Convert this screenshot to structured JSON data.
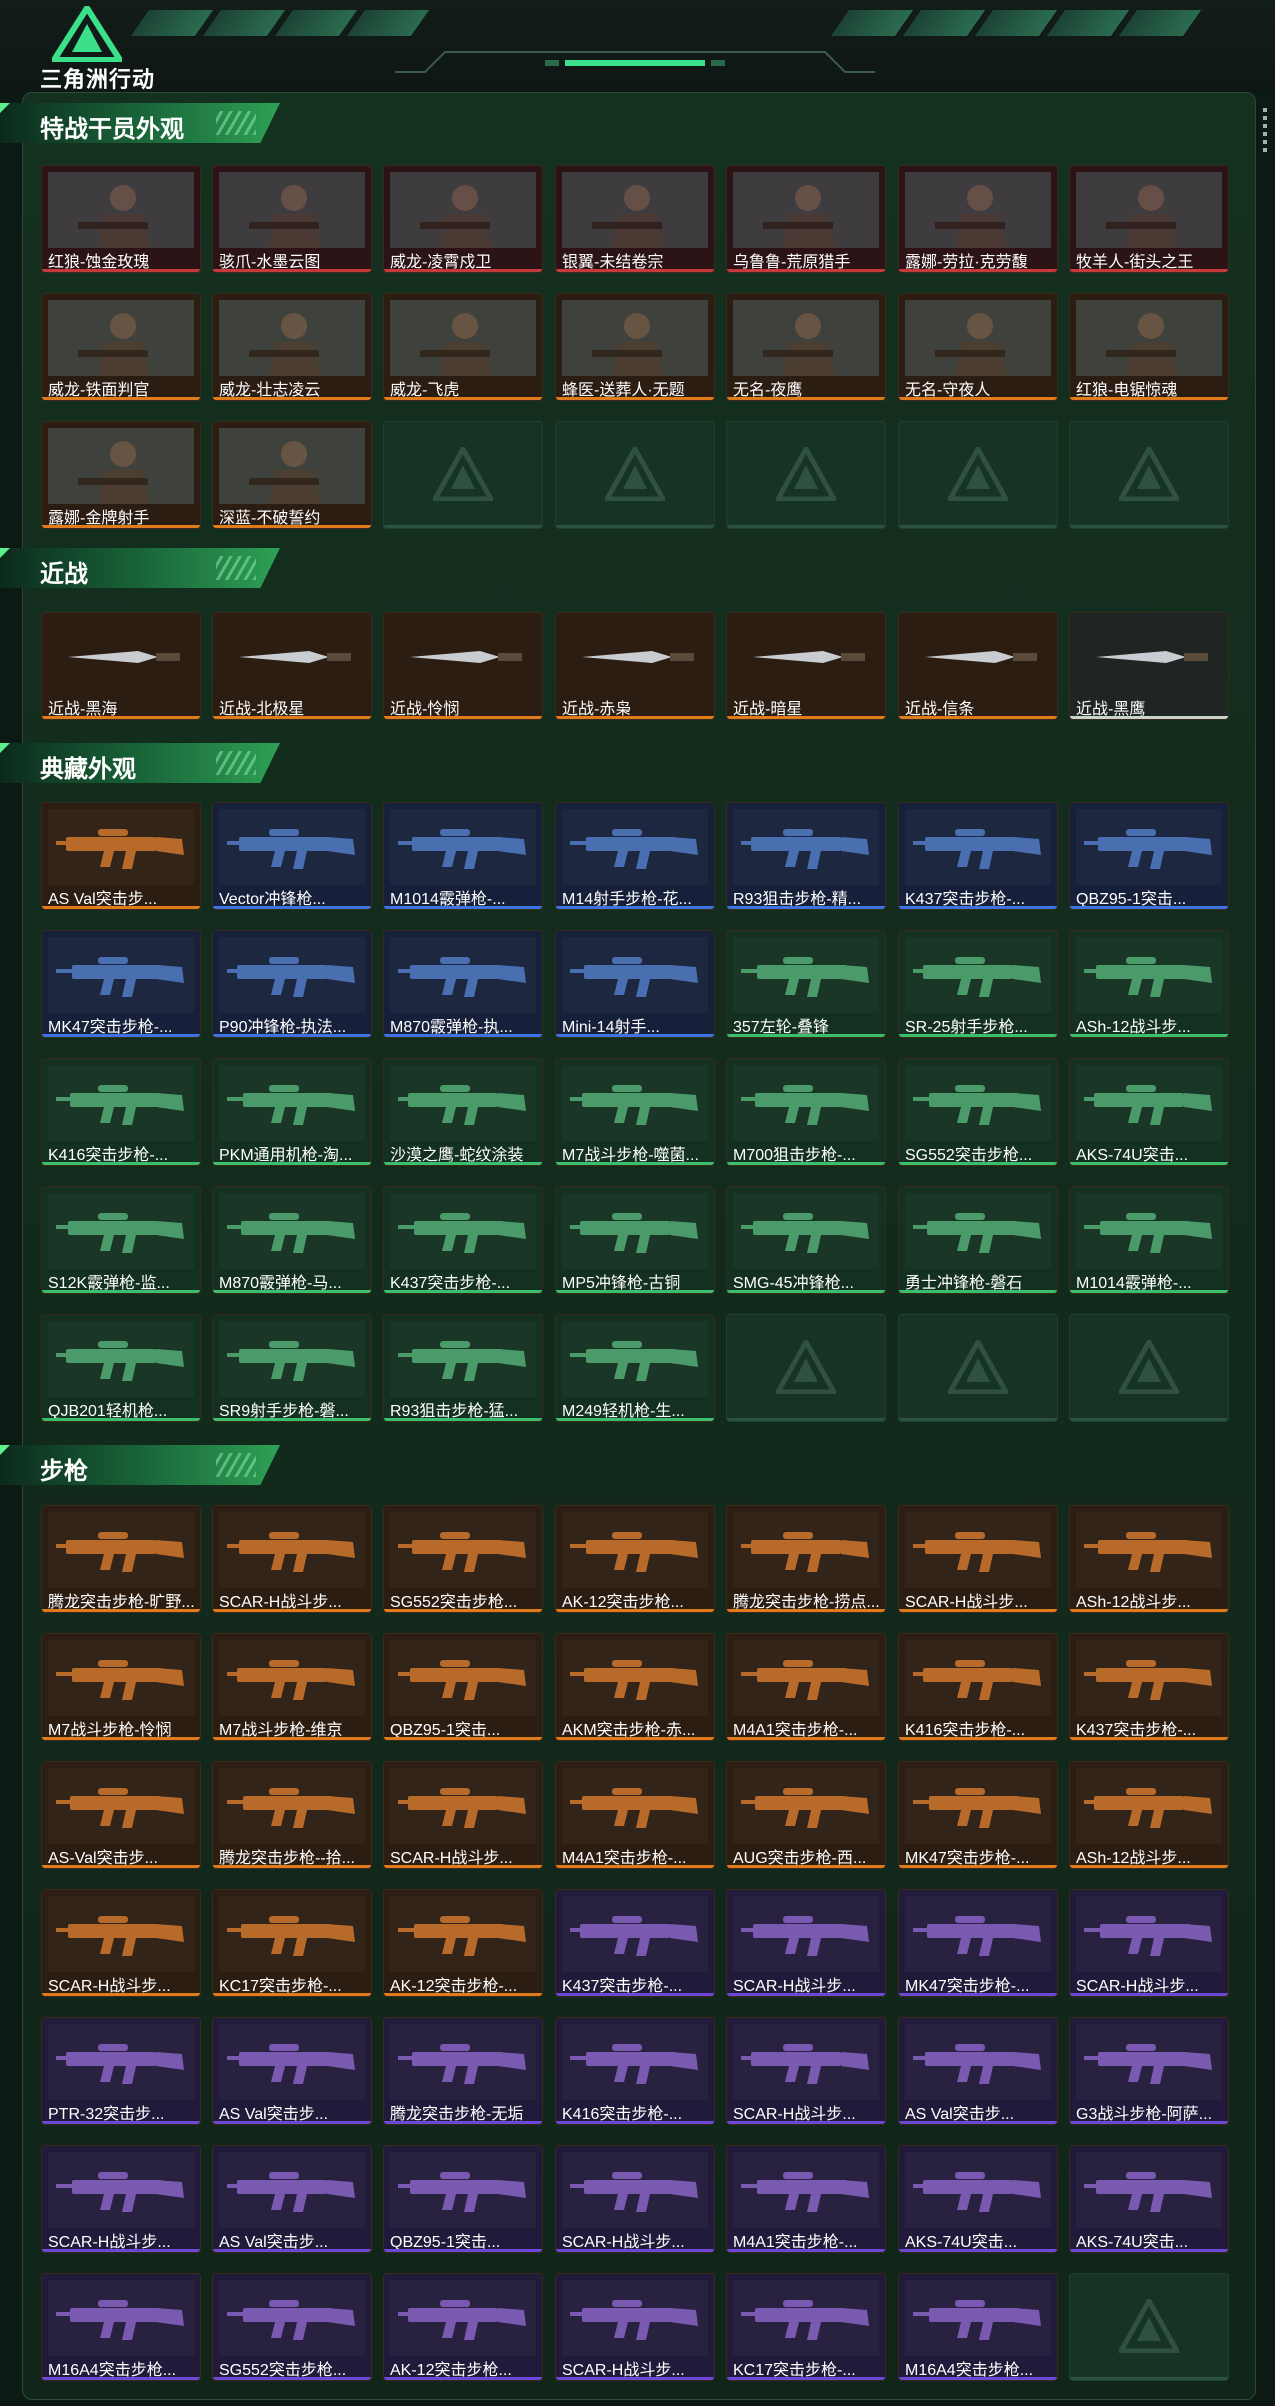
{
  "app": {
    "logo_text": "三角洲行动"
  },
  "colors": {
    "background": "#0d1a14",
    "accent": "#2ea155",
    "rarity_orange": "#e07b1c",
    "rarity_red": "#c53a3a",
    "rarity_blue": "#3b73e0",
    "rarity_purple": "#6b49d6",
    "rarity_green": "#3bbf6a",
    "rarity_white": "#c9d3cd"
  },
  "sections": [
    {
      "title": "特战干员外观",
      "items": [
        {
          "label": "红狼-蚀金玫瑰",
          "rarity": "red"
        },
        {
          "label": "骇爪-水墨云图",
          "rarity": "red"
        },
        {
          "label": "威龙-凌霄戍卫",
          "rarity": "red"
        },
        {
          "label": "银翼-未结卷宗",
          "rarity": "red"
        },
        {
          "label": "乌鲁鲁-荒原猎手",
          "rarity": "red"
        },
        {
          "label": "露娜-劳拉·克劳馥",
          "rarity": "red"
        },
        {
          "label": "牧羊人-街头之王",
          "rarity": "red"
        },
        {
          "label": "威龙-铁面判官",
          "rarity": "orange"
        },
        {
          "label": "威龙-壮志凌云",
          "rarity": "orange"
        },
        {
          "label": "威龙-飞虎",
          "rarity": "orange"
        },
        {
          "label": "蜂医-送葬人·无题",
          "rarity": "orange"
        },
        {
          "label": "无名-夜鹰",
          "rarity": "orange"
        },
        {
          "label": "无名-守夜人",
          "rarity": "orange"
        },
        {
          "label": "红狼-电锯惊魂",
          "rarity": "orange"
        },
        {
          "label": "露娜-金牌射手",
          "rarity": "orange"
        },
        {
          "label": "深蓝-不破誓约",
          "rarity": "orange"
        },
        {
          "label": "",
          "rarity": "empty"
        },
        {
          "label": "",
          "rarity": "empty"
        },
        {
          "label": "",
          "rarity": "empty"
        },
        {
          "label": "",
          "rarity": "empty"
        },
        {
          "label": "",
          "rarity": "empty"
        }
      ]
    },
    {
      "title": "近战",
      "items": [
        {
          "label": "近战-黑海",
          "rarity": "orange"
        },
        {
          "label": "近战-北极星",
          "rarity": "orange"
        },
        {
          "label": "近战-怜悯",
          "rarity": "orange"
        },
        {
          "label": "近战-赤枭",
          "rarity": "orange"
        },
        {
          "label": "近战-暗星",
          "rarity": "orange"
        },
        {
          "label": "近战-信条",
          "rarity": "orange"
        },
        {
          "label": "近战-黑鹰",
          "rarity": "white"
        }
      ]
    },
    {
      "title": "典藏外观",
      "items": [
        {
          "label": "AS Val突击步...",
          "rarity": "orange"
        },
        {
          "label": "Vector冲锋枪...",
          "rarity": "blue"
        },
        {
          "label": "M1014霰弹枪-...",
          "rarity": "blue"
        },
        {
          "label": "M14射手步枪-花...",
          "rarity": "blue"
        },
        {
          "label": "R93狙击步枪-精...",
          "rarity": "blue"
        },
        {
          "label": "K437突击步枪-...",
          "rarity": "blue"
        },
        {
          "label": "QBZ95-1突击...",
          "rarity": "blue"
        },
        {
          "label": "MK47突击步枪-...",
          "rarity": "blue"
        },
        {
          "label": "P90冲锋枪-执法...",
          "rarity": "blue"
        },
        {
          "label": "M870霰弹枪-执...",
          "rarity": "blue"
        },
        {
          "label": "Mini-14射手...",
          "rarity": "blue"
        },
        {
          "label": "357左轮-叠锋",
          "rarity": "green"
        },
        {
          "label": "SR-25射手步枪...",
          "rarity": "green"
        },
        {
          "label": "ASh-12战斗步...",
          "rarity": "green"
        },
        {
          "label": "K416突击步枪-...",
          "rarity": "green"
        },
        {
          "label": "PKM通用机枪-淘...",
          "rarity": "green"
        },
        {
          "label": "沙漠之鹰-蛇纹涂装",
          "rarity": "green"
        },
        {
          "label": "M7战斗步枪-噬菌...",
          "rarity": "green"
        },
        {
          "label": "M700狙击步枪-...",
          "rarity": "green"
        },
        {
          "label": "SG552突击步枪...",
          "rarity": "green"
        },
        {
          "label": "AKS-74U突击...",
          "rarity": "green"
        },
        {
          "label": "S12K霰弹枪-监...",
          "rarity": "green"
        },
        {
          "label": "M870霰弹枪-马...",
          "rarity": "green"
        },
        {
          "label": "K437突击步枪-...",
          "rarity": "green"
        },
        {
          "label": "MP5冲锋枪-古铜",
          "rarity": "green"
        },
        {
          "label": "SMG-45冲锋枪...",
          "rarity": "green"
        },
        {
          "label": "勇士冲锋枪-磐石",
          "rarity": "green"
        },
        {
          "label": "M1014霰弹枪-...",
          "rarity": "green"
        },
        {
          "label": "QJB201轻机枪...",
          "rarity": "green"
        },
        {
          "label": "SR9射手步枪-磐...",
          "rarity": "green"
        },
        {
          "label": "R93狙击步枪-猛...",
          "rarity": "green"
        },
        {
          "label": "M249轻机枪-生...",
          "rarity": "green"
        },
        {
          "label": "",
          "rarity": "empty"
        },
        {
          "label": "",
          "rarity": "empty"
        },
        {
          "label": "",
          "rarity": "empty"
        }
      ]
    },
    {
      "title": "步枪",
      "items": [
        {
          "label": "腾龙突击步枪-旷野...",
          "rarity": "orange"
        },
        {
          "label": "SCAR-H战斗步...",
          "rarity": "orange"
        },
        {
          "label": "SG552突击步枪...",
          "rarity": "orange"
        },
        {
          "label": "AK-12突击步枪...",
          "rarity": "orange"
        },
        {
          "label": "腾龙突击步枪-捞点...",
          "rarity": "orange"
        },
        {
          "label": "SCAR-H战斗步...",
          "rarity": "orange"
        },
        {
          "label": "ASh-12战斗步...",
          "rarity": "orange"
        },
        {
          "label": "M7战斗步枪-怜悯",
          "rarity": "orange"
        },
        {
          "label": "M7战斗步枪-维京",
          "rarity": "orange"
        },
        {
          "label": "QBZ95-1突击...",
          "rarity": "orange"
        },
        {
          "label": "AKM突击步枪-赤...",
          "rarity": "orange"
        },
        {
          "label": "M4A1突击步枪-...",
          "rarity": "orange"
        },
        {
          "label": "K416突击步枪-...",
          "rarity": "orange"
        },
        {
          "label": "K437突击步枪-...",
          "rarity": "orange"
        },
        {
          "label": "AS-Val突击步...",
          "rarity": "orange"
        },
        {
          "label": "腾龙突击步枪--拾...",
          "rarity": "orange"
        },
        {
          "label": "SCAR-H战斗步...",
          "rarity": "orange"
        },
        {
          "label": "M4A1突击步枪-...",
          "rarity": "orange"
        },
        {
          "label": "AUG突击步枪-西...",
          "rarity": "orange"
        },
        {
          "label": "MK47突击步枪-...",
          "rarity": "orange"
        },
        {
          "label": "ASh-12战斗步...",
          "rarity": "orange"
        },
        {
          "label": "SCAR-H战斗步...",
          "rarity": "orange"
        },
        {
          "label": "KC17突击步枪-...",
          "rarity": "orange"
        },
        {
          "label": "AK-12突击步枪-...",
          "rarity": "orange"
        },
        {
          "label": "K437突击步枪-...",
          "rarity": "purple"
        },
        {
          "label": "SCAR-H战斗步...",
          "rarity": "purple"
        },
        {
          "label": "MK47突击步枪-...",
          "rarity": "purple"
        },
        {
          "label": "SCAR-H战斗步...",
          "rarity": "purple"
        },
        {
          "label": "PTR-32突击步...",
          "rarity": "purple"
        },
        {
          "label": "AS Val突击步...",
          "rarity": "purple"
        },
        {
          "label": "腾龙突击步枪-无垢",
          "rarity": "purple"
        },
        {
          "label": "K416突击步枪-...",
          "rarity": "purple"
        },
        {
          "label": "SCAR-H战斗步...",
          "rarity": "purple"
        },
        {
          "label": "AS Val突击步...",
          "rarity": "purple"
        },
        {
          "label": "G3战斗步枪-阿萨...",
          "rarity": "purple"
        },
        {
          "label": "SCAR-H战斗步...",
          "rarity": "purple"
        },
        {
          "label": "AS Val突击步...",
          "rarity": "purple"
        },
        {
          "label": "QBZ95-1突击...",
          "rarity": "purple"
        },
        {
          "label": "SCAR-H战斗步...",
          "rarity": "purple"
        },
        {
          "label": "M4A1突击步枪-...",
          "rarity": "purple"
        },
        {
          "label": "AKS-74U突击...",
          "rarity": "purple"
        },
        {
          "label": "AKS-74U突击...",
          "rarity": "purple"
        },
        {
          "label": "M16A4突击步枪...",
          "rarity": "purple"
        },
        {
          "label": "SG552突击步枪...",
          "rarity": "purple"
        },
        {
          "label": "AK-12突击步枪...",
          "rarity": "purple"
        },
        {
          "label": "SCAR-H战斗步...",
          "rarity": "purple"
        },
        {
          "label": "KC17突击步枪-...",
          "rarity": "purple"
        },
        {
          "label": "M16A4突击步枪...",
          "rarity": "purple"
        },
        {
          "label": "",
          "rarity": "empty"
        }
      ]
    }
  ]
}
